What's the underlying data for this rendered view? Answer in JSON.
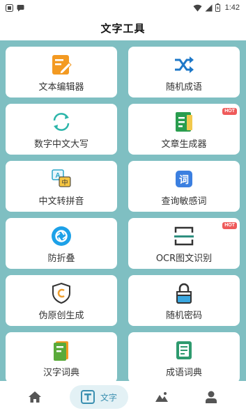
{
  "status_bar": {
    "time": "1:42",
    "icons": [
      "app-icon",
      "message-icon",
      "wifi-icon",
      "signal-icon",
      "battery-icon"
    ]
  },
  "header": {
    "title": "文字工具"
  },
  "tools": [
    {
      "label": "文本编辑器",
      "icon": "note-edit-icon",
      "color": "#f39a22"
    },
    {
      "label": "随机成语",
      "icon": "shuffle-icon",
      "color": "#1e78c8"
    },
    {
      "label": "数字中文大写",
      "icon": "convert-cycle-icon",
      "color": "#2bb5a9"
    },
    {
      "label": "文章生成器",
      "icon": "article-icon",
      "color": "#2a9d4f",
      "badge": "HOT"
    },
    {
      "label": "中文转拼音",
      "icon": "pinyin-icon",
      "color": "#2aa6c9"
    },
    {
      "label": "查询敏感词",
      "icon": "word-query-icon",
      "color": "#3b7fe0"
    },
    {
      "label": "防折叠",
      "icon": "aperture-icon",
      "color": "#1da1e8"
    },
    {
      "label": "OCR图文识别",
      "icon": "scan-icon",
      "color": "#2f8f80",
      "badge": "HOT"
    },
    {
      "label": "伪原创生成",
      "icon": "shield-c-icon",
      "color": "#f0a030"
    },
    {
      "label": "随机密码",
      "icon": "lock-icon",
      "color": "#3aa7e0"
    },
    {
      "label": "汉字词典",
      "icon": "book-icon",
      "color": "#5aaa3a"
    },
    {
      "label": "成语词典",
      "icon": "idiom-book-icon",
      "color": "#2e9a6e"
    }
  ],
  "bottom_nav": {
    "active_label": "文字",
    "accent_color": "#3a8fb0",
    "items": [
      "home-icon",
      "text-tool-icon",
      "image-icon",
      "profile-icon"
    ]
  }
}
